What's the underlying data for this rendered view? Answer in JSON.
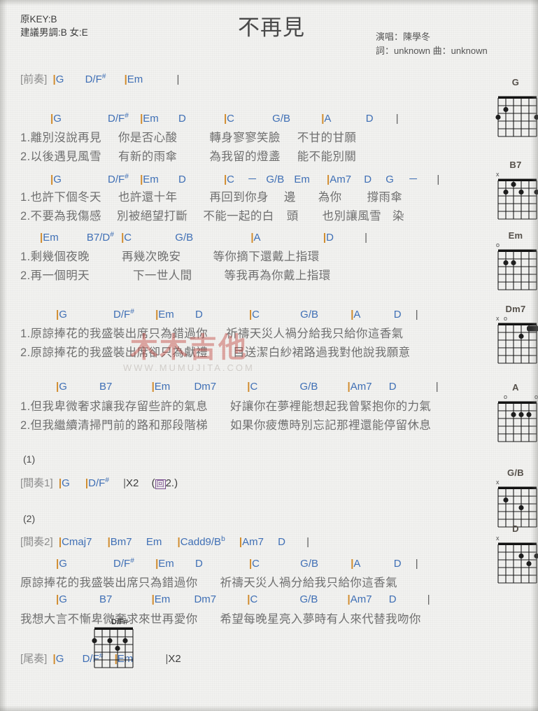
{
  "header": {
    "original_key": "原KEY:B",
    "suggested_key": "建議男調:B 女:E",
    "title": "不再見",
    "singer": "演唱：陳學冬",
    "writers": "詞：unknown   曲：unknown"
  },
  "watermark": {
    "main": "木木吉他",
    "sub": "WWW.MUMUJITA.COM"
  },
  "sections": {
    "intro_tag": "[前奏]",
    "interlude1_tag": "[間奏1]",
    "interlude2_tag": "[間奏2]",
    "outro_tag": "[尾奏]",
    "marker1": "(1)",
    "marker2": "(2)",
    "repeat_x2": "|X2",
    "repeat_back": "(回2.)"
  },
  "blocks": [
    {
      "id": "intro",
      "chords": "|G    D/F#    |Em        |",
      "lyrics": []
    },
    {
      "id": "verse1a",
      "chords": "|G      D/F#  |Em   D      |C    G/B    |A     D    |",
      "lyrics": [
        "1.離別沒說再見　你是否心酸　　轉身寥寥笑臉　不甘的甘願",
        "2.以後遇見風雪　有新的雨傘　　為我留的燈盞　能不能別關"
      ]
    },
    {
      "id": "verse1b",
      "chords": "|G      D/F#  |Em   D      |C  －  G/B  Em   |Am7  D  G  －   |",
      "lyrics": [
        "1.也許下個冬天　也許還十年　　再回到你身　邊　　為你　　撐雨傘",
        "2.不要為我傷感　別被絕望打斷　不能一起的白　頭　　也別讓風雪 染"
      ]
    },
    {
      "id": "verse1c",
      "chords": "|Em    B7/D#  |C        G/B        |A          |D      |",
      "lyrics": [
        "1.剩幾個夜晚　　再幾次晚安　　等你摘下還戴上指環",
        "2.再一個明天　　下一世人間　　等我再為你戴上指環"
      ]
    },
    {
      "id": "chorus1a",
      "chords": "|G      D/F#   |Em   D      |C      G/B     |A     D   |",
      "lyrics": [
        "1.原諒捧花的我盛裝出席只為錯過你　　祈禱天災人禍分給我只給你這香氣",
        "2.原諒捧花的我盛裝出席卻只為獻禮　　目送潔白紗裙路過我對他說我願意"
      ]
    },
    {
      "id": "chorus1b",
      "chords": "|G     B7      |Em    Dm7     |C     G/B     |Am7   D      |",
      "lyrics": [
        "1.但我卑微奢求讓我存留些許的氣息　　好讓你在夢裡能想起我曾緊抱你的力氣",
        "2.但我繼續清掃門前的路和那段階梯　　如果你疲憊時別忘記那裡還能停留休息"
      ]
    },
    {
      "id": "interlude1",
      "chords": "|G    |D/F#    |X2   (回2.)",
      "lyrics": []
    },
    {
      "id": "interlude2",
      "chords": "|Cmaj7   |Bm7   Em   |Cadd9/Bb    |Am7   D    |",
      "lyrics": []
    },
    {
      "id": "chorus2a",
      "chords": "|G      D/F#   |Em   D      |C      G/B     |A     D   |",
      "lyrics": [
        "原諒捧花的我盛裝出席只為錯過你　　祈禱天災人禍分給我只給你這香氣"
      ]
    },
    {
      "id": "chorus2b",
      "chords": "|G     B7      |Em    Dm7     |C     G/B     |Am7   D      |",
      "lyrics": [
        "我想大言不慚卑微奢求來世再愛你　　希望每晚星亮入夢時有人來代替我吻你"
      ]
    },
    {
      "id": "outro",
      "chords": "|G    D/F#    |Em       |X2",
      "lyrics": []
    }
  ],
  "chord_tokens": {
    "intro": [
      "|G",
      "D/F#",
      "|Em",
      "|"
    ],
    "v1a": [
      "|G",
      "D/F#",
      "|Em",
      "D",
      "|C",
      "G/B",
      "|A",
      "D",
      "|"
    ],
    "v1b": [
      "|G",
      "D/F#",
      "|Em",
      "D",
      "|C",
      "－",
      "G/B",
      "Em",
      "|Am7",
      "D",
      "G",
      "－",
      "|"
    ],
    "v1c": [
      "|Em",
      "B7/D#",
      "|C",
      "G/B",
      "|A",
      "|D",
      "|"
    ],
    "c1a": [
      "|G",
      "D/F#",
      "|Em",
      "D",
      "|C",
      "G/B",
      "|A",
      "D",
      "|"
    ],
    "c1b": [
      "|G",
      "B7",
      "|Em",
      "Dm7",
      "|C",
      "G/B",
      "|Am7",
      "D",
      "|"
    ],
    "i1": [
      "|G",
      "|D/F#",
      "|X2",
      "(回2.)"
    ],
    "i2": [
      "|Cmaj7",
      "|Bm7",
      "Em",
      "|Cadd9/Bb",
      "|Am7",
      "D",
      "|"
    ],
    "out": [
      "|G",
      "D/F#",
      "|Em",
      "|X2"
    ]
  },
  "lyrics_text": {
    "v1a_1": "1.離別沒說再見",
    "v1a_1b": "你是否心酸",
    "v1a_1c": "轉身寥寥笑臉",
    "v1a_1d": "不甘的甘願",
    "v1a_2": "2.以後遇見風雪",
    "v1a_2b": "有新的雨傘",
    "v1a_2c": "為我留的燈盞",
    "v1a_2d": "能不能別關",
    "v1b_1": "1.也許下個冬天",
    "v1b_1b": "也許還十年",
    "v1b_1c": "再回到你身",
    "v1b_1d": "邊",
    "v1b_1e": "為你",
    "v1b_1f": "撐雨傘",
    "v1b_2": "2.不要為我傷感",
    "v1b_2b": "別被絕望打斷",
    "v1b_2c": "不能一起的白",
    "v1b_2d": "頭",
    "v1b_2e": "也別讓風雪",
    "v1b_2f": "染",
    "v1c_1": "1.剩幾個夜晚",
    "v1c_1b": "再幾次晚安",
    "v1c_1c": "等你摘下還戴上指環",
    "v1c_2": "2.再一個明天",
    "v1c_2b": "下一世人間",
    "v1c_2c": "等我再為你戴上指環",
    "c1a_1": "1.原諒捧花的我盛裝出席只為錯過你",
    "c1a_1b": "祈禱天災人禍分給我只給你這香氣",
    "c1a_2": "2.原諒捧花的我盛裝出席卻只為獻禮",
    "c1a_2b": "目送潔白紗裙路過我對他說我願意",
    "c1b_1": "1.但我卑微奢求讓我存留些許的氣息",
    "c1b_1b": "好讓你在夢裡能想起我曾緊抱你的力氣",
    "c1b_2": "2.但我繼續清掃門前的路和那段階梯",
    "c1b_2b": "如果你疲憊時別忘記那裡還能停留休息",
    "c2a_1": "原諒捧花的我盛裝出席只為錯過你",
    "c2a_1b": "祈禱天災人禍分給我只給你這香氣",
    "c2b_1": "我想大言不慚卑微奢求來世再愛你",
    "c2b_1b": "希望每晚星亮入夢時有人來代替我吻你"
  },
  "diagrams": [
    {
      "name": "G",
      "markers": [],
      "dots": [
        {
          "string": 5,
          "fret": 2
        },
        {
          "string": 6,
          "fret": 3
        },
        {
          "string": 1,
          "fret": 3
        }
      ],
      "barre": null
    },
    {
      "name": "B7",
      "markers": [
        {
          "string": 6,
          "symbol": "x"
        }
      ],
      "dots": [
        {
          "string": 5,
          "fret": 2
        },
        {
          "string": 4,
          "fret": 1
        },
        {
          "string": 3,
          "fret": 2
        },
        {
          "string": 1,
          "fret": 2
        }
      ],
      "barre": null
    },
    {
      "name": "Em",
      "markers": [
        {
          "string": 6,
          "symbol": "o"
        }
      ],
      "dots": [
        {
          "string": 5,
          "fret": 2
        },
        {
          "string": 4,
          "fret": 2
        }
      ],
      "barre": null
    },
    {
      "name": "Dm7",
      "markers": [
        {
          "string": 6,
          "symbol": "x"
        },
        {
          "string": 5,
          "symbol": "o"
        }
      ],
      "dots": [
        {
          "string": 3,
          "fret": 2
        }
      ],
      "barre": {
        "fret": 1,
        "from": 2,
        "to": 1
      }
    },
    {
      "name": "A",
      "markers": [
        {
          "string": 5,
          "symbol": "o"
        },
        {
          "string": 1,
          "symbol": "o"
        }
      ],
      "dots": [
        {
          "string": 4,
          "fret": 2
        },
        {
          "string": 3,
          "fret": 2
        },
        {
          "string": 2,
          "fret": 2
        }
      ],
      "barre": null
    },
    {
      "name": "G/B",
      "markers": [
        {
          "string": 6,
          "symbol": "x"
        }
      ],
      "dots": [
        {
          "string": 5,
          "fret": 2
        },
        {
          "string": 3,
          "fret": 3
        }
      ],
      "barre": null
    },
    {
      "name": "D",
      "markers": [
        {
          "string": 6,
          "symbol": "x"
        }
      ],
      "dots": [
        {
          "string": 3,
          "fret": 2
        },
        {
          "string": 1,
          "fret": 2
        },
        {
          "string": 2,
          "fret": 3
        }
      ],
      "barre": null
    }
  ],
  "inline_diagram": {
    "name": "D/F#",
    "markers": [],
    "dots": [
      {
        "string": 6,
        "fret": 2
      },
      {
        "string": 4,
        "fret": 2
      },
      {
        "string": 2,
        "fret": 2
      },
      {
        "string": 3,
        "fret": 3
      }
    ]
  }
}
